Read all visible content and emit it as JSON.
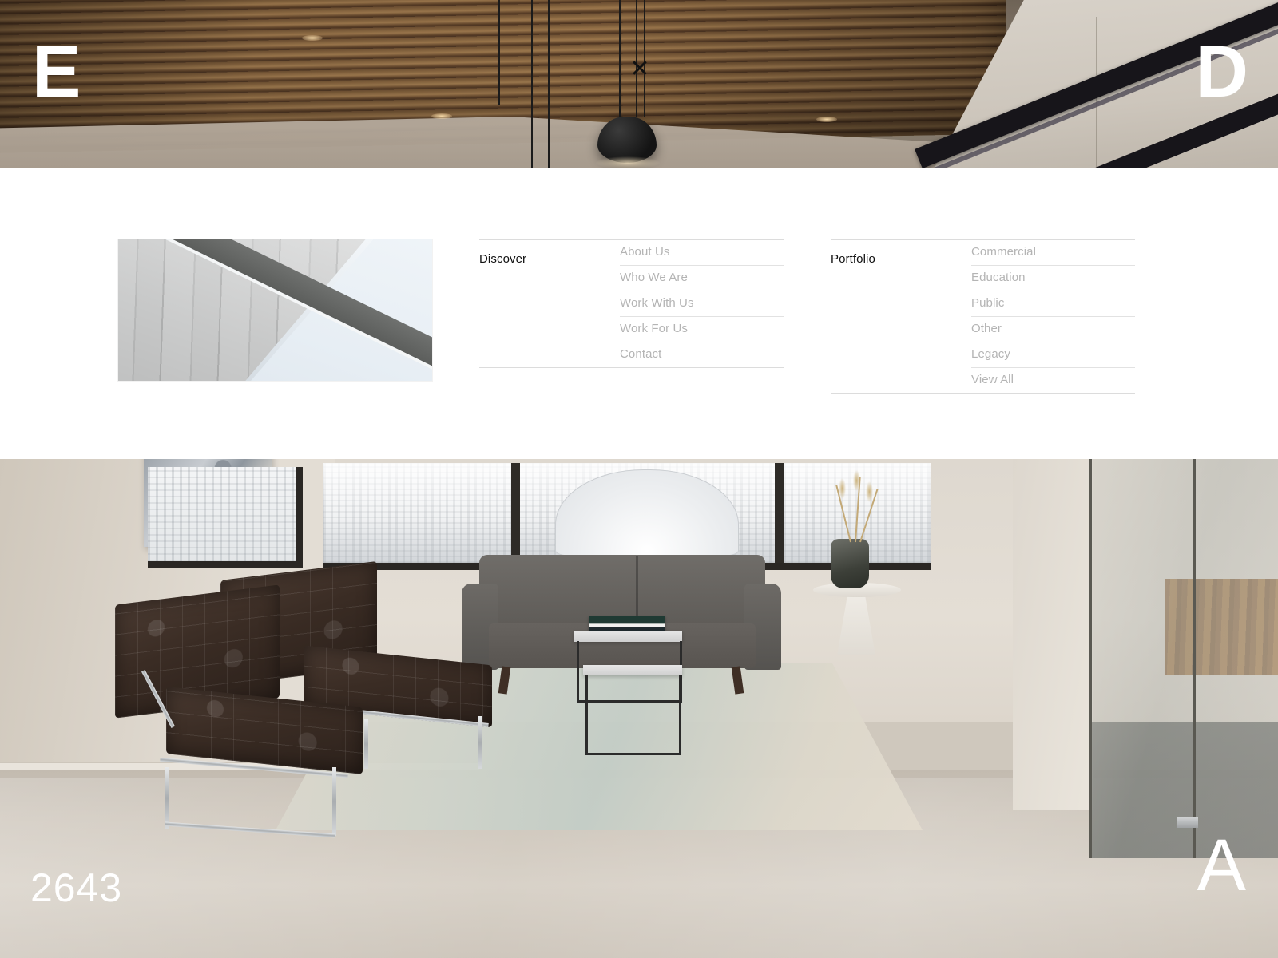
{
  "corners": {
    "top_left_letter": "E",
    "top_right_letter": "D",
    "bottom_right_letter": "A",
    "bottom_left_number": "2643"
  },
  "nav_panel": {
    "thumbnail": {
      "alt": "architectural building facade against pale sky"
    },
    "columns": [
      {
        "title": "Discover",
        "links": [
          "About Us",
          "Who We Are",
          "Work With Us",
          "Work For Us",
          "Contact"
        ]
      },
      {
        "title": "Portfolio",
        "links": [
          "Commercial",
          "Education",
          "Public",
          "Other",
          "Legacy",
          "View All"
        ]
      }
    ]
  },
  "hero_top": {
    "alt": "wooden slat ceiling with black pendant lamps in modern office lobby"
  },
  "hero_bottom": {
    "alt": "office lounge with brown tufted leather chairs, grey sofa, nesting tables and city view windows"
  },
  "colors": {
    "panel_background": "#ffffff",
    "heading_text": "#111111",
    "link_text": "#b4b4b4",
    "divider": "#e2e2e2",
    "column_rule": "#dcdcdc",
    "glyph": "#ffffff"
  }
}
